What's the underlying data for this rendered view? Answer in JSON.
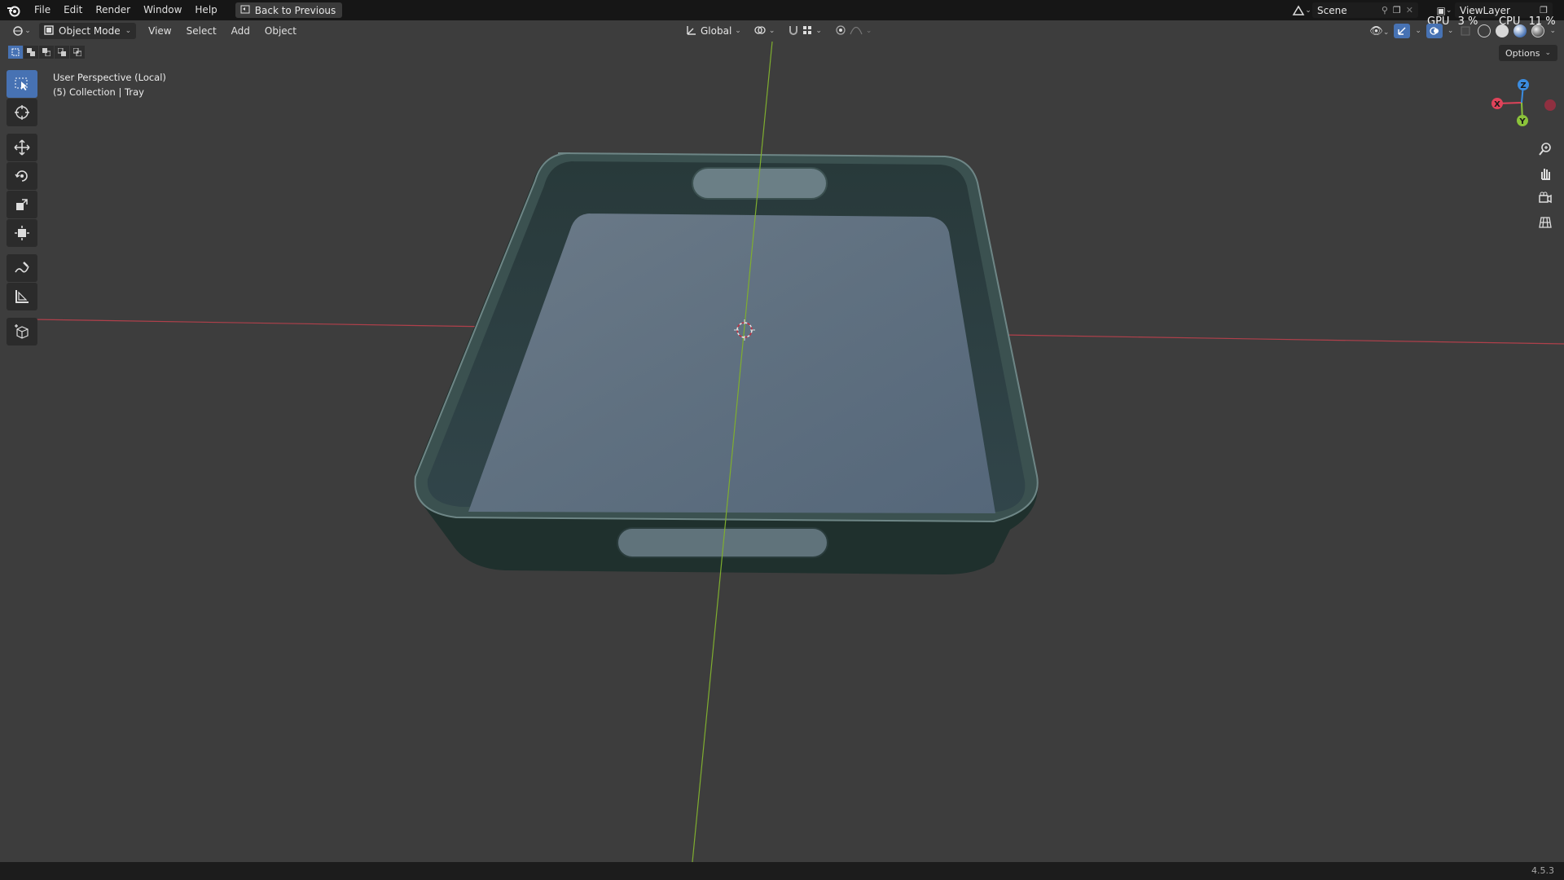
{
  "top_menu": {
    "items": [
      "File",
      "Edit",
      "Render",
      "Window",
      "Help"
    ],
    "back_button": "Back to Previous"
  },
  "scene": {
    "name": "Scene"
  },
  "view_layer": {
    "name": "ViewLayer"
  },
  "stats": {
    "gpu_label": "GPU",
    "gpu_value": "3 %",
    "cpu_label": "CPU",
    "cpu_value": "11 %"
  },
  "viewport_header": {
    "mode": "Object Mode",
    "menus": [
      "View",
      "Select",
      "Add",
      "Object"
    ],
    "transform_orientation": "Global"
  },
  "options_label": "Options",
  "overlay": {
    "view_name": "User Perspective (Local)",
    "collection_info": "(5) Collection | Tray"
  },
  "gizmo": {
    "x": "X",
    "y": "Y",
    "z": "Z"
  },
  "version": "4.5.3",
  "colors": {
    "accent": "#4772b3",
    "x_axis": "#e0435a",
    "y_axis": "#8bc33a",
    "z_axis": "#3b8ce0",
    "background": "#3d3d3d"
  },
  "tools": [
    "select-box",
    "cursor",
    "move",
    "rotate",
    "scale",
    "transform",
    "annotate",
    "measure",
    "add-cube"
  ]
}
